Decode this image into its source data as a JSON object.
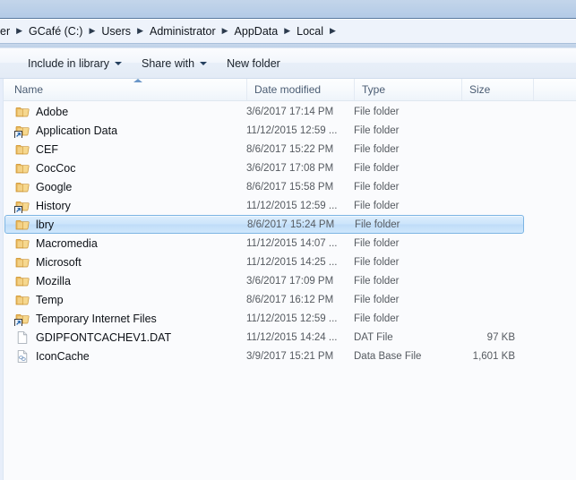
{
  "breadcrumb": {
    "clipped_prefix": "er",
    "separator": "▶",
    "items": [
      {
        "label": "GCafé (C:)"
      },
      {
        "label": "Users"
      },
      {
        "label": "Administrator"
      },
      {
        "label": "AppData"
      },
      {
        "label": "Local"
      }
    ]
  },
  "toolbar": {
    "items": [
      {
        "label": "Include in library",
        "has_caret": true
      },
      {
        "label": "Share with",
        "has_caret": true
      },
      {
        "label": "New folder",
        "has_caret": false
      }
    ]
  },
  "columns": {
    "name": "Name",
    "date_modified": "Date modified",
    "type": "Type",
    "size": "Size",
    "sort_by": "Name",
    "sort_direction": "ascending"
  },
  "colors": {
    "selection_border": "#7bb4e3",
    "selection_fill": "#cbe4fb",
    "chrome": "#bacfe8",
    "folder_icon": "#f0c571",
    "header_text": "#4a5c73"
  },
  "files": [
    {
      "name": "Adobe",
      "date": "3/6/2017 17:14 PM",
      "type": "File folder",
      "size": "",
      "icon": "folder-icon",
      "selected": false
    },
    {
      "name": "Application Data",
      "date": "11/12/2015 12:59 ...",
      "type": "File folder",
      "size": "",
      "icon": "folder-shortcut-icon",
      "selected": false
    },
    {
      "name": "CEF",
      "date": "8/6/2017 15:22 PM",
      "type": "File folder",
      "size": "",
      "icon": "folder-icon",
      "selected": false
    },
    {
      "name": "CocCoc",
      "date": "3/6/2017 17:08 PM",
      "type": "File folder",
      "size": "",
      "icon": "folder-icon",
      "selected": false
    },
    {
      "name": "Google",
      "date": "8/6/2017 15:58 PM",
      "type": "File folder",
      "size": "",
      "icon": "folder-icon",
      "selected": false
    },
    {
      "name": "History",
      "date": "11/12/2015 12:59 ...",
      "type": "File folder",
      "size": "",
      "icon": "folder-shortcut-icon",
      "selected": false
    },
    {
      "name": "lbry",
      "date": "8/6/2017 15:24 PM",
      "type": "File folder",
      "size": "",
      "icon": "folder-icon",
      "selected": true
    },
    {
      "name": "Macromedia",
      "date": "11/12/2015 14:07 ...",
      "type": "File folder",
      "size": "",
      "icon": "folder-icon",
      "selected": false
    },
    {
      "name": "Microsoft",
      "date": "11/12/2015 14:25 ...",
      "type": "File folder",
      "size": "",
      "icon": "folder-icon",
      "selected": false
    },
    {
      "name": "Mozilla",
      "date": "3/6/2017 17:09 PM",
      "type": "File folder",
      "size": "",
      "icon": "folder-icon",
      "selected": false
    },
    {
      "name": "Temp",
      "date": "8/6/2017 16:12 PM",
      "type": "File folder",
      "size": "",
      "icon": "folder-icon",
      "selected": false
    },
    {
      "name": "Temporary Internet Files",
      "date": "11/12/2015 12:59 ...",
      "type": "File folder",
      "size": "",
      "icon": "folder-shortcut-icon",
      "selected": false
    },
    {
      "name": "GDIPFONTCACHEV1.DAT",
      "date": "11/12/2015 14:24 ...",
      "type": "DAT File",
      "size": "97 KB",
      "icon": "blank-file-icon",
      "selected": false
    },
    {
      "name": "IconCache",
      "date": "3/9/2017 15:21 PM",
      "type": "Data Base File",
      "size": "1,601 KB",
      "icon": "database-file-icon",
      "selected": false
    }
  ]
}
